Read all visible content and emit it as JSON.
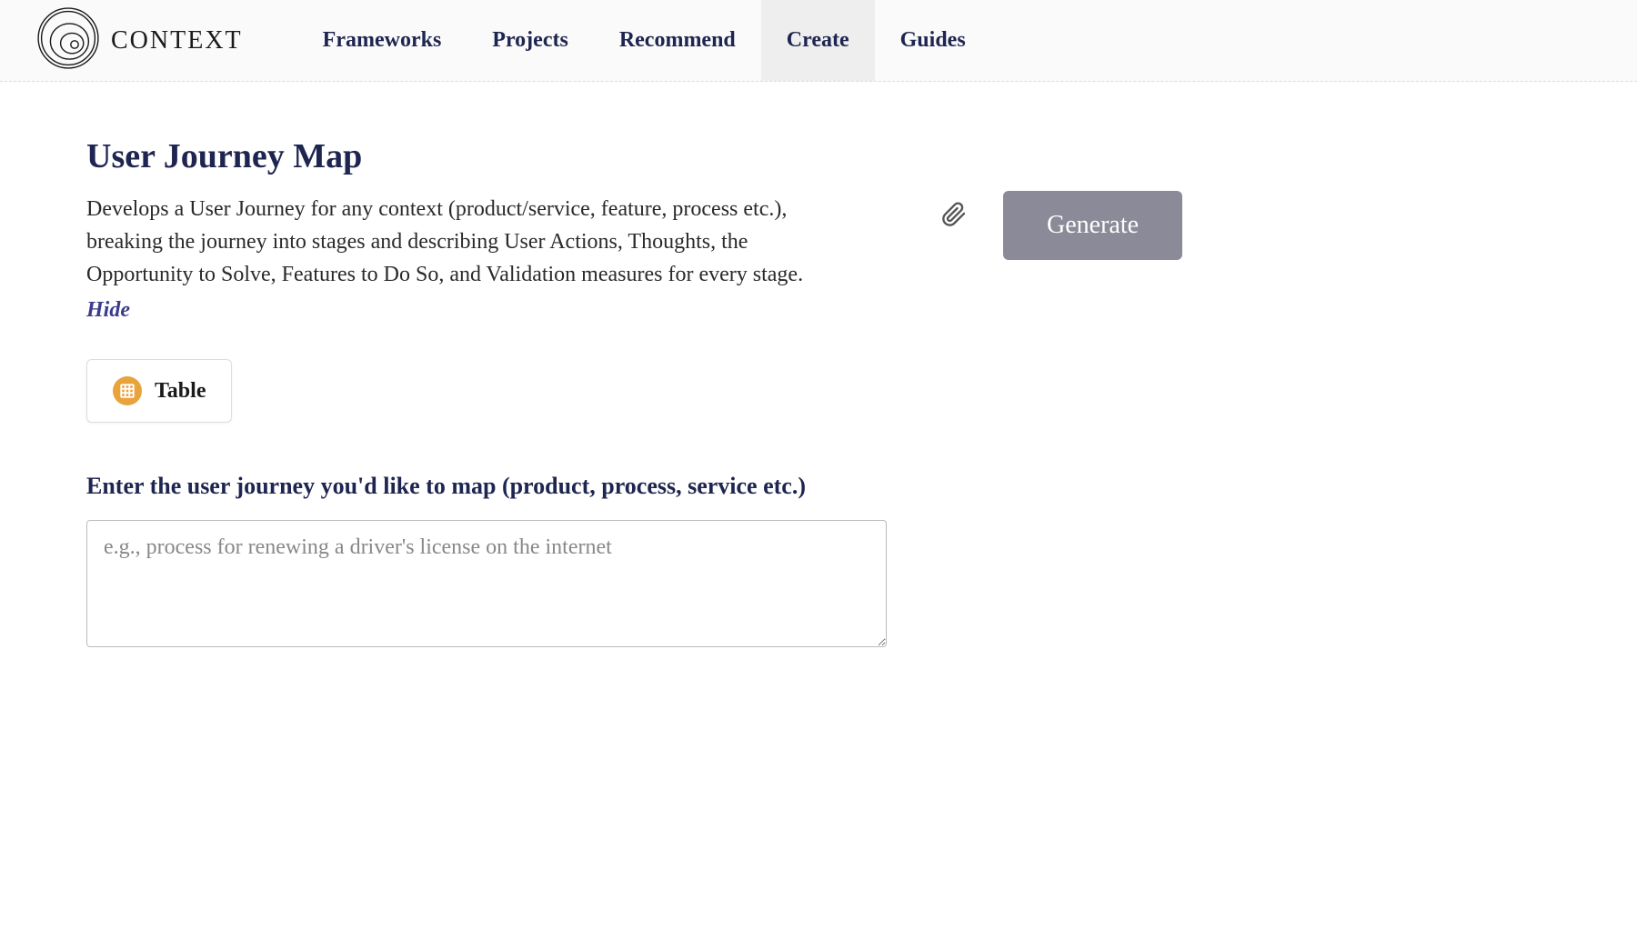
{
  "brand": {
    "name": "CONTEXT"
  },
  "nav": {
    "items": [
      {
        "label": "Frameworks",
        "active": false
      },
      {
        "label": "Projects",
        "active": false
      },
      {
        "label": "Recommend",
        "active": false
      },
      {
        "label": "Create",
        "active": true
      },
      {
        "label": "Guides",
        "active": false
      }
    ]
  },
  "page": {
    "title": "User Journey Map",
    "description": "Develops a User Journey for any context (product/service, feature, process etc.), breaking the journey into stages and describing User Actions, Thoughts, the Opportunity to Solve, Features to Do So, and Validation measures for every stage.",
    "hide_label": "Hide"
  },
  "output_format": {
    "label": "Table"
  },
  "form": {
    "input_label": "Enter the user journey you'd like to map (product, process, service etc.)",
    "placeholder": "e.g., process for renewing a driver's license on the internet",
    "value": ""
  },
  "actions": {
    "generate_label": "Generate"
  }
}
